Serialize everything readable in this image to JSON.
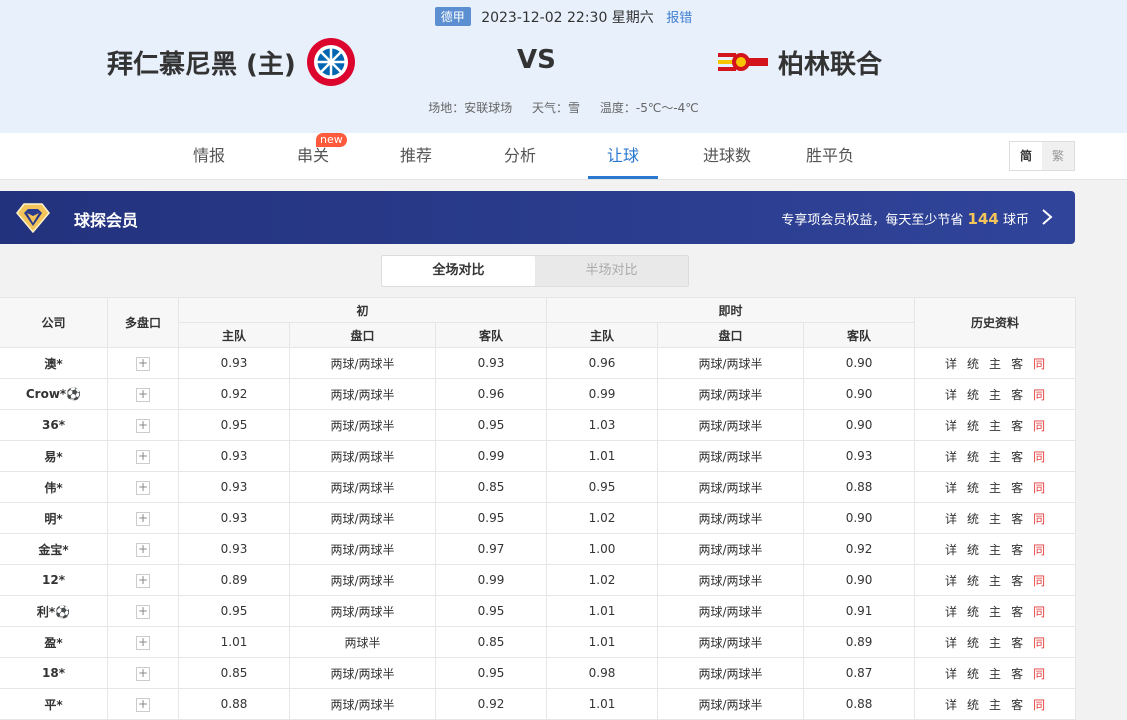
{
  "header": {
    "league": "德甲",
    "datetime": "2023-12-02 22:30 星期六",
    "report": "报错",
    "home_team": "拜仁慕尼黑 (主)",
    "vs": "VS",
    "away_team": "柏林联合",
    "venue": "场地：安联球场",
    "weather": "天气：雪",
    "temperature": "温度：-5℃～-4℃"
  },
  "tabs": [
    {
      "label": "情报"
    },
    {
      "label": "串关",
      "badge": "new"
    },
    {
      "label": "推荐"
    },
    {
      "label": "分析"
    },
    {
      "label": "让球",
      "active": true
    },
    {
      "label": "进球数"
    },
    {
      "label": "胜平负"
    }
  ],
  "lang": {
    "simplified": "简",
    "traditional": "繁"
  },
  "vip": {
    "title": "球探会员",
    "desc_prefix": "专享项会员权益，每天至少节省",
    "desc_number": "144",
    "desc_suffix": "球币"
  },
  "toggle": {
    "full": "全场对比",
    "half": "半场对比"
  },
  "table": {
    "headers": {
      "company": "公司",
      "multi": "多盘口",
      "initial": "初",
      "live": "即时",
      "history": "历史资料",
      "home": "主队",
      "line": "盘口",
      "away": "客队"
    },
    "history_links": [
      "详",
      "统",
      "主",
      "客",
      "同"
    ],
    "rows": [
      {
        "company": "澳*",
        "i_home": "0.93",
        "i_line": "两球/两球半",
        "i_away": "0.93",
        "l_home": "0.96",
        "l_line": "两球/两球半",
        "l_away": "0.90"
      },
      {
        "company": "Crow*⚽",
        "i_home": "0.92",
        "i_line": "两球/两球半",
        "i_away": "0.96",
        "l_home": "0.99",
        "l_line": "两球/两球半",
        "l_away": "0.90"
      },
      {
        "company": "36*",
        "i_home": "0.95",
        "i_line": "两球/两球半",
        "i_away": "0.95",
        "l_home": "1.03",
        "l_line": "两球/两球半",
        "l_away": "0.90"
      },
      {
        "company": "易*",
        "i_home": "0.93",
        "i_line": "两球/两球半",
        "i_away": "0.99",
        "l_home": "1.01",
        "l_line": "两球/两球半",
        "l_away": "0.93"
      },
      {
        "company": "伟*",
        "i_home": "0.93",
        "i_line": "两球/两球半",
        "i_away": "0.85",
        "l_home": "0.95",
        "l_line": "两球/两球半",
        "l_away": "0.88"
      },
      {
        "company": "明*",
        "i_home": "0.93",
        "i_line": "两球/两球半",
        "i_away": "0.95",
        "l_home": "1.02",
        "l_line": "两球/两球半",
        "l_away": "0.90"
      },
      {
        "company": "金宝*",
        "i_home": "0.93",
        "i_line": "两球/两球半",
        "i_away": "0.97",
        "l_home": "1.00",
        "l_line": "两球/两球半",
        "l_away": "0.92"
      },
      {
        "company": "12*",
        "i_home": "0.89",
        "i_line": "两球/两球半",
        "i_away": "0.99",
        "l_home": "1.02",
        "l_line": "两球/两球半",
        "l_away": "0.90"
      },
      {
        "company": "利*⚽",
        "i_home": "0.95",
        "i_line": "两球/两球半",
        "i_away": "0.95",
        "l_home": "1.01",
        "l_line": "两球/两球半",
        "l_away": "0.91"
      },
      {
        "company": "盈*",
        "i_home": "1.01",
        "i_line": "两球半",
        "i_away": "0.85",
        "l_home": "1.01",
        "l_line": "两球/两球半",
        "l_away": "0.89"
      },
      {
        "company": "18*",
        "i_home": "0.85",
        "i_line": "两球/两球半",
        "i_away": "0.95",
        "l_home": "0.98",
        "l_line": "两球/两球半",
        "l_away": "0.87"
      },
      {
        "company": "平*",
        "i_home": "0.88",
        "i_line": "两球/两球半",
        "i_away": "0.92",
        "l_home": "1.01",
        "l_line": "两球/两球半",
        "l_away": "0.88"
      }
    ]
  }
}
